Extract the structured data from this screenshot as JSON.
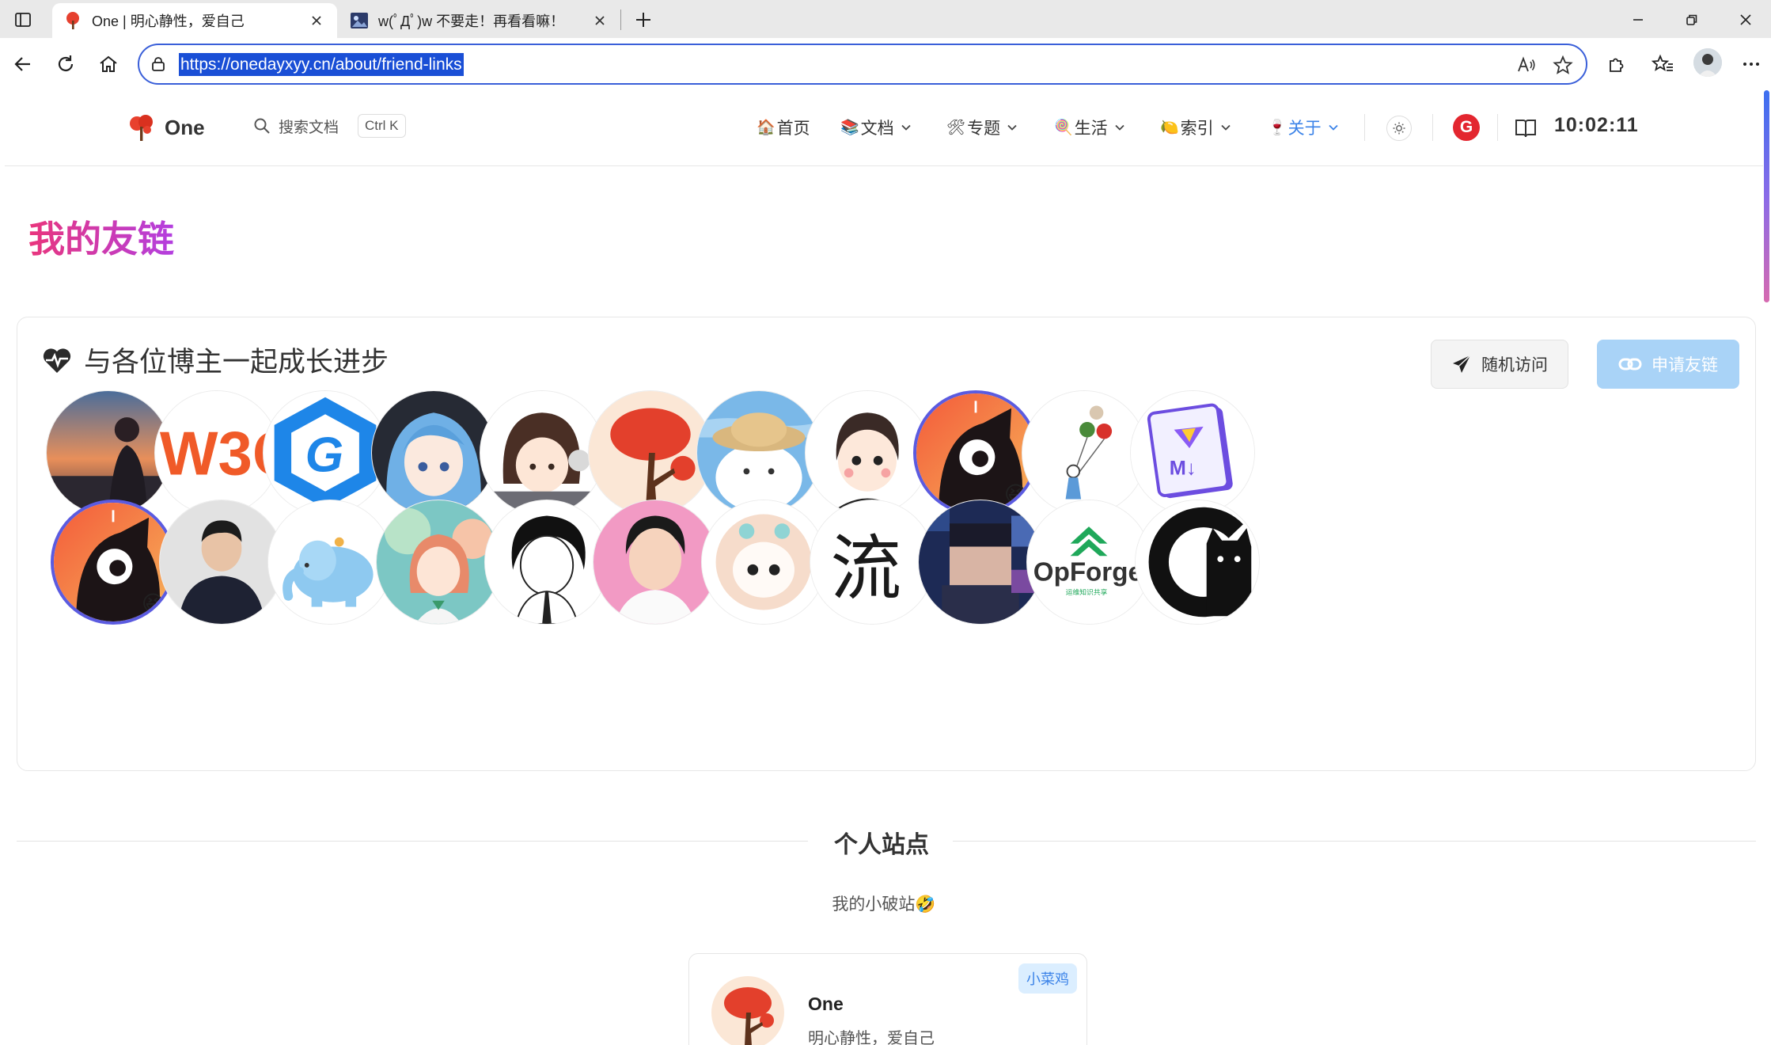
{
  "browser": {
    "tabs": [
      {
        "title": "One | 明心静性，爱自己"
      },
      {
        "title": "w(ﾟДﾟ)w 不要走！再看看嘛！"
      }
    ],
    "url": "https://onedayxyy.cn/about/friend-links"
  },
  "site": {
    "brand": "One",
    "search_label": "搜索文档",
    "search_kbd": "Ctrl K",
    "menu": [
      {
        "emoji": "🏠",
        "label": "首页"
      },
      {
        "emoji": "📚",
        "label": "文档"
      },
      {
        "emoji": "🛠",
        "label": "专题"
      },
      {
        "emoji": "🍭",
        "label": "生活"
      },
      {
        "emoji": "🍋",
        "label": "索引"
      },
      {
        "emoji": "🍷",
        "label": "关于"
      }
    ],
    "g_label": "G",
    "clock": "10:02:11"
  },
  "page": {
    "title": "我的友链",
    "panel_title": "与各位博主一起成长进步",
    "random_button": "随机访问",
    "apply_button": "申请友链",
    "avatar_texts": {
      "w3c": "W3C",
      "g": "G",
      "md": "M↓",
      "opforge": "OpForge",
      "opforge_sub": "运维知识共享",
      "calligraphy": "流"
    },
    "avatar_badge": "😆",
    "section_title": "个人站点",
    "section_sub": "我的小破站🤣",
    "card": {
      "name": "One",
      "desc": "明心静性，爱自己",
      "tag": "小菜鸡"
    }
  },
  "colors": {
    "accent": "#3a82e8",
    "title_gradient_start": "#e9357c",
    "title_gradient_end": "#b33fe0",
    "apply_button": "#a9d3f7",
    "address_border": "#3a5fd9"
  }
}
